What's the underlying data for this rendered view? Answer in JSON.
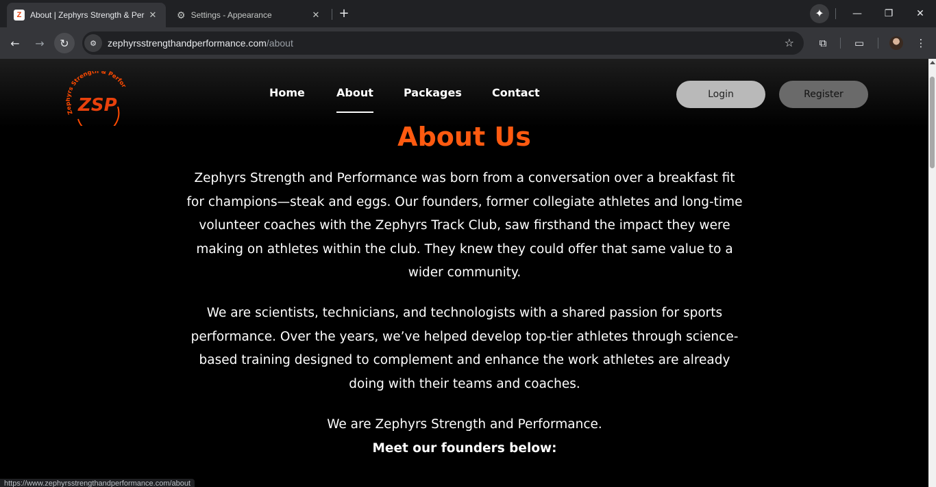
{
  "browser": {
    "tabs": [
      {
        "title": "About | Zephyrs Strength & Per",
        "favicon": "Z",
        "active": true
      },
      {
        "title": "Settings - Appearance",
        "icon": "gear-icon",
        "active": false
      }
    ],
    "url_host": "zephyrsstrengthandperformance.com",
    "url_path": "/about",
    "status_url": "https://www.zephyrsstrengthandperformance.com/about"
  },
  "site": {
    "logo_text": "ZSP",
    "logo_arc_text": "Zephyrs Strength & Performance",
    "nav": [
      "Home",
      "About",
      "Packages",
      "Contact"
    ],
    "active_nav": "About",
    "login_label": "Login",
    "register_label": "Register"
  },
  "content": {
    "heading": "About Us",
    "paragraph1": "Zephyrs Strength and Performance was born from a conversation over a breakfast fit for champions—steak and eggs. Our founders, former collegiate athletes and long-time volunteer coaches with the Zephyrs Track Club, saw firsthand the impact they were making on athletes within the club. They knew they could offer that same value to a wider community.",
    "paragraph2": "We are scientists, technicians, and technologists with a shared passion for sports performance. Over the years, we’ve helped develop top-tier athletes through science-based training designed to complement and enhance the work athletes are already doing with their teams and coaches.",
    "tagline": "We are Zephyrs Strength and Performance.",
    "founders_intro": "Meet our founders below:"
  },
  "colors": {
    "accent": "#ff5a10",
    "chrome_dark": "#202124",
    "chrome_mid": "#35363a"
  }
}
